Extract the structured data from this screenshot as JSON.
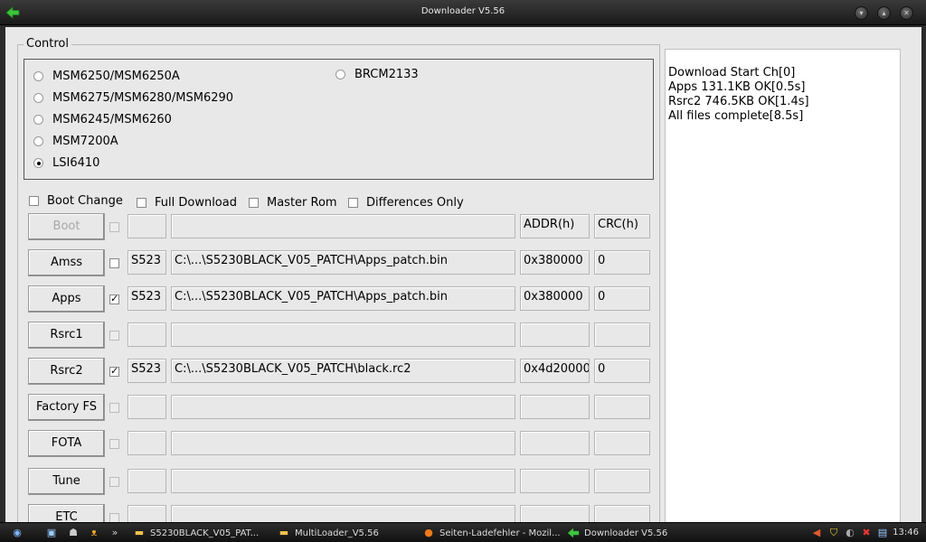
{
  "window": {
    "title": "Downloader V5.56"
  },
  "control": {
    "legend": "Control",
    "chips": [
      {
        "label": "MSM6250/MSM6250A",
        "selected": false
      },
      {
        "label": "MSM6275/MSM6280/MSM6290",
        "selected": false
      },
      {
        "label": "MSM6245/MSM6260",
        "selected": false
      },
      {
        "label": "MSM7200A",
        "selected": false
      },
      {
        "label": "LSI6410",
        "selected": true
      },
      {
        "label": "BRCM2133",
        "selected": false
      }
    ],
    "options": [
      {
        "label": "Boot Change",
        "checked": false
      },
      {
        "label": "Full Download",
        "checked": false
      },
      {
        "label": "Master Rom",
        "checked": false
      },
      {
        "label": "Differences Only",
        "checked": false
      }
    ]
  },
  "rows": [
    {
      "button": "Boot",
      "enabled": false,
      "checked": false,
      "id": "",
      "path": "",
      "addr": "ADDR(h)",
      "crc": "CRC(h)"
    },
    {
      "button": "Amss",
      "enabled": true,
      "checked": false,
      "id": "S523",
      "path": "C:\\...\\S5230BLACK_V05_PATCH\\Apps_patch.bin",
      "addr": "0x380000",
      "crc": "0"
    },
    {
      "button": "Apps",
      "enabled": true,
      "checked": true,
      "id": "S523",
      "path": "C:\\...\\S5230BLACK_V05_PATCH\\Apps_patch.bin",
      "addr": "0x380000",
      "crc": "0"
    },
    {
      "button": "Rsrc1",
      "enabled": true,
      "checked": false,
      "id": "",
      "path": "",
      "addr": "",
      "crc": ""
    },
    {
      "button": "Rsrc2",
      "enabled": true,
      "checked": true,
      "id": "S523",
      "path": "C:\\...\\S5230BLACK_V05_PATCH\\black.rc2",
      "addr": "0x4d20000",
      "crc": "0"
    },
    {
      "button": "Factory FS",
      "enabled": true,
      "checked": false,
      "id": "",
      "path": "",
      "addr": "",
      "crc": ""
    },
    {
      "button": "FOTA",
      "enabled": true,
      "checked": false,
      "id": "",
      "path": "",
      "addr": "",
      "crc": ""
    },
    {
      "button": "Tune",
      "enabled": true,
      "checked": false,
      "id": "",
      "path": "",
      "addr": "",
      "crc": ""
    },
    {
      "button": "ETC",
      "enabled": true,
      "checked": false,
      "id": "",
      "path": "",
      "addr": "",
      "crc": ""
    }
  ],
  "log": [
    "Download Start Ch[0]",
    "Apps 131.1KB OK[0.5s]",
    "Rsrc2 746.5KB OK[1.4s]",
    "All files complete[8.5s]"
  ],
  "taskbar": {
    "tasks": [
      {
        "label": "S5230BLACK_V05_PAT...",
        "icon": "folder-icon"
      },
      {
        "label": "MultiLoader_V5.56",
        "icon": "folder-icon"
      },
      {
        "label": "Seiten-Ladefehler - Mozil...",
        "icon": "firefox-icon"
      },
      {
        "label": "Downloader V5.56",
        "icon": "green-arrow-icon"
      }
    ],
    "clock": "13:46"
  },
  "colors": {
    "accent_arrow": "#3cc43c",
    "form_bg": "#e8e8e8"
  }
}
